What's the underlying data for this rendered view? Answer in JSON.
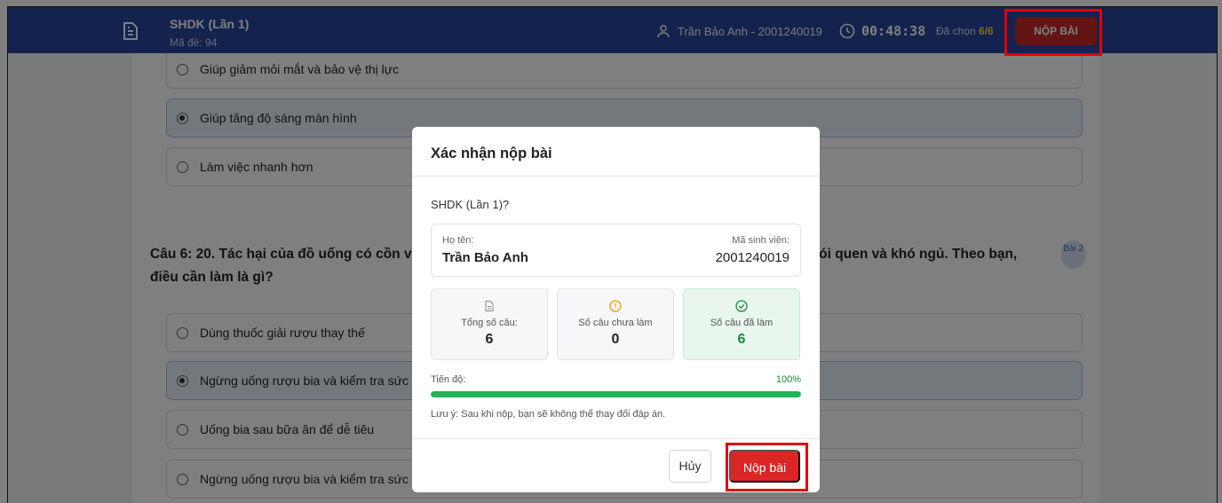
{
  "header": {
    "exam_title": "SHDK (Lần 1)",
    "exam_code": "Mã đề: 94",
    "user": "Trần Bảo Anh - 2001240019",
    "timer": "00:48:38",
    "chosen_label": "Đã chọn",
    "chosen_value": "6/6",
    "submit_label": "NỘP BÀI"
  },
  "question_prev": {
    "options": [
      {
        "text": "Giúp giảm mỏi mắt và bảo vệ thị lực",
        "selected": false
      },
      {
        "text": "Giúp tăng độ sáng màn hình",
        "selected": true
      },
      {
        "text": "Làm việc nhanh hơn",
        "selected": false
      }
    ]
  },
  "question": {
    "text": "Câu 6: 20. Tác hại của đồ uống có cồn                                                                                              với bạn bè. Dù ban đầu chỉ uống ít, nhưng dần dần trở thành thói quen                                                                                             và khó ngủ. Theo bạn, điều cần làm là gì?",
    "badge": "Bài 2",
    "options": [
      {
        "text": "Dùng thuốc giải rượu thay thế",
        "selected": false
      },
      {
        "text": "Ngừng uống rượu bia và kiểm tra sức",
        "selected": true
      },
      {
        "text": "Uống bia sau bữa ăn để dễ tiêu",
        "selected": false
      },
      {
        "text": "Ngừng uống rượu bia và kiểm tra sức",
        "selected": false
      }
    ]
  },
  "modal": {
    "title": "Xác nhận nộp bài",
    "subtitle": "SHDK (Lần 1)?",
    "name_label": "Họ tên:",
    "name_value": "Trần Bảo Anh",
    "id_label": "Mã sinh viên:",
    "id_value": "2001240019",
    "stats": [
      {
        "label": "Tổng số câu:",
        "value": "6",
        "icon": "document-icon"
      },
      {
        "label": "Số câu chưa làm",
        "value": "0",
        "icon": "warning-icon"
      },
      {
        "label": "Số câu đã làm",
        "value": "6",
        "icon": "check-circle-icon"
      }
    ],
    "progress_label": "Tiến độ:",
    "progress_text": "100%",
    "progress_value": 1.0,
    "note": "Lưu ý: Sau khi nộp, bạn sẽ không thể thay đổi đáp án.",
    "cancel_label": "Hủy",
    "submit_label": "Nộp bài"
  },
  "colors": {
    "header_bg": "#28479a",
    "submit_red": "#dc2626",
    "progress_green": "#22b45a",
    "highlight_outline": "#e00000"
  }
}
